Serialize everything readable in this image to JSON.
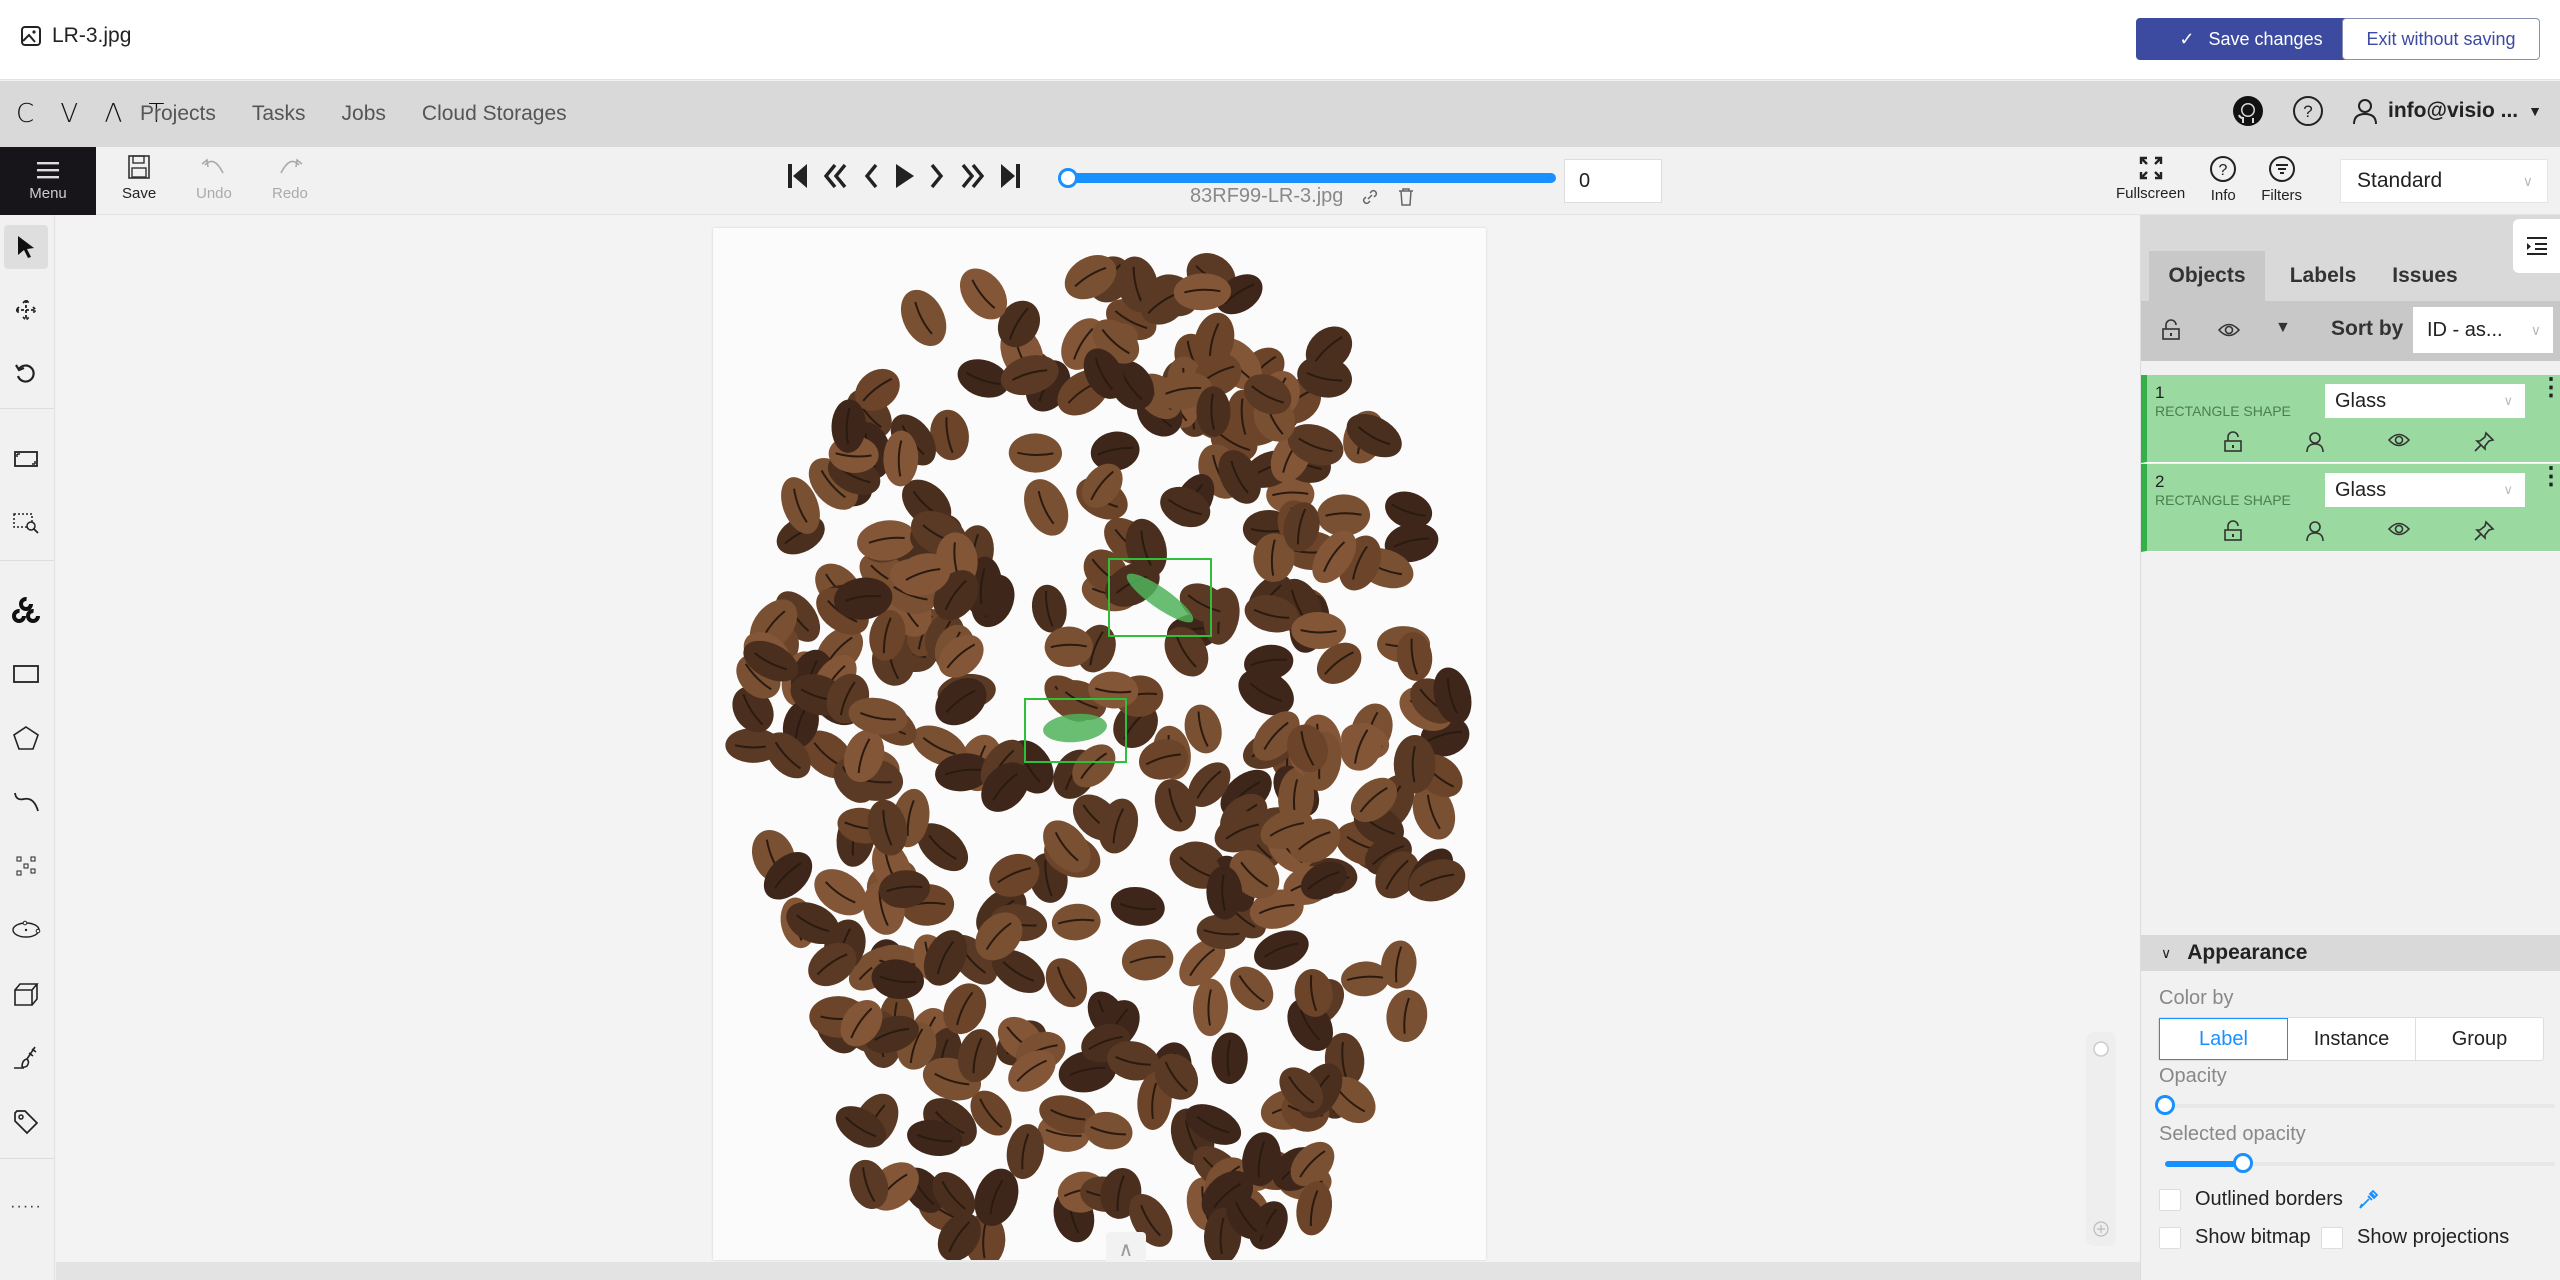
{
  "filebar": {
    "filename": "LR-3.jpg",
    "save_changes_label": "Save changes",
    "exit_label": "Exit without saving"
  },
  "header": {
    "logo": "CVAT",
    "nav": [
      "Projects",
      "Tasks",
      "Jobs",
      "Cloud Storages"
    ],
    "user": "info@visio ..."
  },
  "toolbar": {
    "menu_label": "Menu",
    "save_label": "Save",
    "undo_label": "Undo",
    "redo_label": "Redo",
    "frame_number": "0",
    "frame_name": "83RF99-LR-3.jpg",
    "frame_progress": 0,
    "fullscreen_label": "Fullscreen",
    "info_label": "Info",
    "filters_label": "Filters",
    "workspace": "Standard"
  },
  "canvas": {
    "annotations": [
      {
        "id": 1,
        "label": "Glass",
        "color": "#2fbf3a"
      },
      {
        "id": 2,
        "label": "Glass",
        "color": "#2fbf3a"
      }
    ]
  },
  "sidebar": {
    "tabs": [
      "Objects",
      "Labels",
      "Issues"
    ],
    "active_tab": "Objects",
    "sort_by_label": "Sort by",
    "sort_by_value": "ID - as...",
    "objects": [
      {
        "id": "1",
        "type": "RECTANGLE SHAPE",
        "label": "Glass"
      },
      {
        "id": "2",
        "type": "RECTANGLE SHAPE",
        "label": "Glass"
      }
    ],
    "appearance": {
      "title": "Appearance",
      "color_by_label": "Color by",
      "color_by_options": [
        "Label",
        "Instance",
        "Group"
      ],
      "color_by_selected": "Label",
      "opacity_label": "Opacity",
      "opacity_value": 0,
      "selected_opacity_label": "Selected opacity",
      "selected_opacity_value": 0.2,
      "outlined_borders_label": "Outlined borders",
      "show_bitmap_label": "Show bitmap",
      "show_projections_label": "Show projections"
    }
  },
  "colors": {
    "accent": "#1890ff",
    "primary_button": "#3c4ba0",
    "object_bg": "#9ad9a0",
    "object_border": "#33b049"
  }
}
